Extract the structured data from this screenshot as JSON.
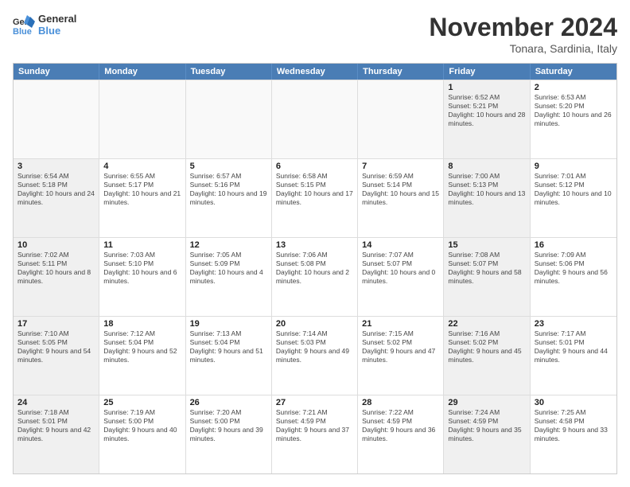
{
  "logo": {
    "line1": "General",
    "line2": "Blue"
  },
  "title": "November 2024",
  "location": "Tonara, Sardinia, Italy",
  "header_days": [
    "Sunday",
    "Monday",
    "Tuesday",
    "Wednesday",
    "Thursday",
    "Friday",
    "Saturday"
  ],
  "weeks": [
    [
      {
        "day": "",
        "info": "",
        "empty": true
      },
      {
        "day": "",
        "info": "",
        "empty": true
      },
      {
        "day": "",
        "info": "",
        "empty": true
      },
      {
        "day": "",
        "info": "",
        "empty": true
      },
      {
        "day": "",
        "info": "",
        "empty": true
      },
      {
        "day": "1",
        "info": "Sunrise: 6:52 AM\nSunset: 5:21 PM\nDaylight: 10 hours and 28 minutes.",
        "shaded": true
      },
      {
        "day": "2",
        "info": "Sunrise: 6:53 AM\nSunset: 5:20 PM\nDaylight: 10 hours and 26 minutes.",
        "shaded": false
      }
    ],
    [
      {
        "day": "3",
        "info": "Sunrise: 6:54 AM\nSunset: 5:18 PM\nDaylight: 10 hours and 24 minutes.",
        "shaded": true
      },
      {
        "day": "4",
        "info": "Sunrise: 6:55 AM\nSunset: 5:17 PM\nDaylight: 10 hours and 21 minutes.",
        "shaded": false
      },
      {
        "day": "5",
        "info": "Sunrise: 6:57 AM\nSunset: 5:16 PM\nDaylight: 10 hours and 19 minutes.",
        "shaded": false
      },
      {
        "day": "6",
        "info": "Sunrise: 6:58 AM\nSunset: 5:15 PM\nDaylight: 10 hours and 17 minutes.",
        "shaded": false
      },
      {
        "day": "7",
        "info": "Sunrise: 6:59 AM\nSunset: 5:14 PM\nDaylight: 10 hours and 15 minutes.",
        "shaded": false
      },
      {
        "day": "8",
        "info": "Sunrise: 7:00 AM\nSunset: 5:13 PM\nDaylight: 10 hours and 13 minutes.",
        "shaded": true
      },
      {
        "day": "9",
        "info": "Sunrise: 7:01 AM\nSunset: 5:12 PM\nDaylight: 10 hours and 10 minutes.",
        "shaded": false
      }
    ],
    [
      {
        "day": "10",
        "info": "Sunrise: 7:02 AM\nSunset: 5:11 PM\nDaylight: 10 hours and 8 minutes.",
        "shaded": true
      },
      {
        "day": "11",
        "info": "Sunrise: 7:03 AM\nSunset: 5:10 PM\nDaylight: 10 hours and 6 minutes.",
        "shaded": false
      },
      {
        "day": "12",
        "info": "Sunrise: 7:05 AM\nSunset: 5:09 PM\nDaylight: 10 hours and 4 minutes.",
        "shaded": false
      },
      {
        "day": "13",
        "info": "Sunrise: 7:06 AM\nSunset: 5:08 PM\nDaylight: 10 hours and 2 minutes.",
        "shaded": false
      },
      {
        "day": "14",
        "info": "Sunrise: 7:07 AM\nSunset: 5:07 PM\nDaylight: 10 hours and 0 minutes.",
        "shaded": false
      },
      {
        "day": "15",
        "info": "Sunrise: 7:08 AM\nSunset: 5:07 PM\nDaylight: 9 hours and 58 minutes.",
        "shaded": true
      },
      {
        "day": "16",
        "info": "Sunrise: 7:09 AM\nSunset: 5:06 PM\nDaylight: 9 hours and 56 minutes.",
        "shaded": false
      }
    ],
    [
      {
        "day": "17",
        "info": "Sunrise: 7:10 AM\nSunset: 5:05 PM\nDaylight: 9 hours and 54 minutes.",
        "shaded": true
      },
      {
        "day": "18",
        "info": "Sunrise: 7:12 AM\nSunset: 5:04 PM\nDaylight: 9 hours and 52 minutes.",
        "shaded": false
      },
      {
        "day": "19",
        "info": "Sunrise: 7:13 AM\nSunset: 5:04 PM\nDaylight: 9 hours and 51 minutes.",
        "shaded": false
      },
      {
        "day": "20",
        "info": "Sunrise: 7:14 AM\nSunset: 5:03 PM\nDaylight: 9 hours and 49 minutes.",
        "shaded": false
      },
      {
        "day": "21",
        "info": "Sunrise: 7:15 AM\nSunset: 5:02 PM\nDaylight: 9 hours and 47 minutes.",
        "shaded": false
      },
      {
        "day": "22",
        "info": "Sunrise: 7:16 AM\nSunset: 5:02 PM\nDaylight: 9 hours and 45 minutes.",
        "shaded": true
      },
      {
        "day": "23",
        "info": "Sunrise: 7:17 AM\nSunset: 5:01 PM\nDaylight: 9 hours and 44 minutes.",
        "shaded": false
      }
    ],
    [
      {
        "day": "24",
        "info": "Sunrise: 7:18 AM\nSunset: 5:01 PM\nDaylight: 9 hours and 42 minutes.",
        "shaded": true
      },
      {
        "day": "25",
        "info": "Sunrise: 7:19 AM\nSunset: 5:00 PM\nDaylight: 9 hours and 40 minutes.",
        "shaded": false
      },
      {
        "day": "26",
        "info": "Sunrise: 7:20 AM\nSunset: 5:00 PM\nDaylight: 9 hours and 39 minutes.",
        "shaded": false
      },
      {
        "day": "27",
        "info": "Sunrise: 7:21 AM\nSunset: 4:59 PM\nDaylight: 9 hours and 37 minutes.",
        "shaded": false
      },
      {
        "day": "28",
        "info": "Sunrise: 7:22 AM\nSunset: 4:59 PM\nDaylight: 9 hours and 36 minutes.",
        "shaded": false
      },
      {
        "day": "29",
        "info": "Sunrise: 7:24 AM\nSunset: 4:59 PM\nDaylight: 9 hours and 35 minutes.",
        "shaded": true
      },
      {
        "day": "30",
        "info": "Sunrise: 7:25 AM\nSunset: 4:58 PM\nDaylight: 9 hours and 33 minutes.",
        "shaded": false
      }
    ]
  ]
}
